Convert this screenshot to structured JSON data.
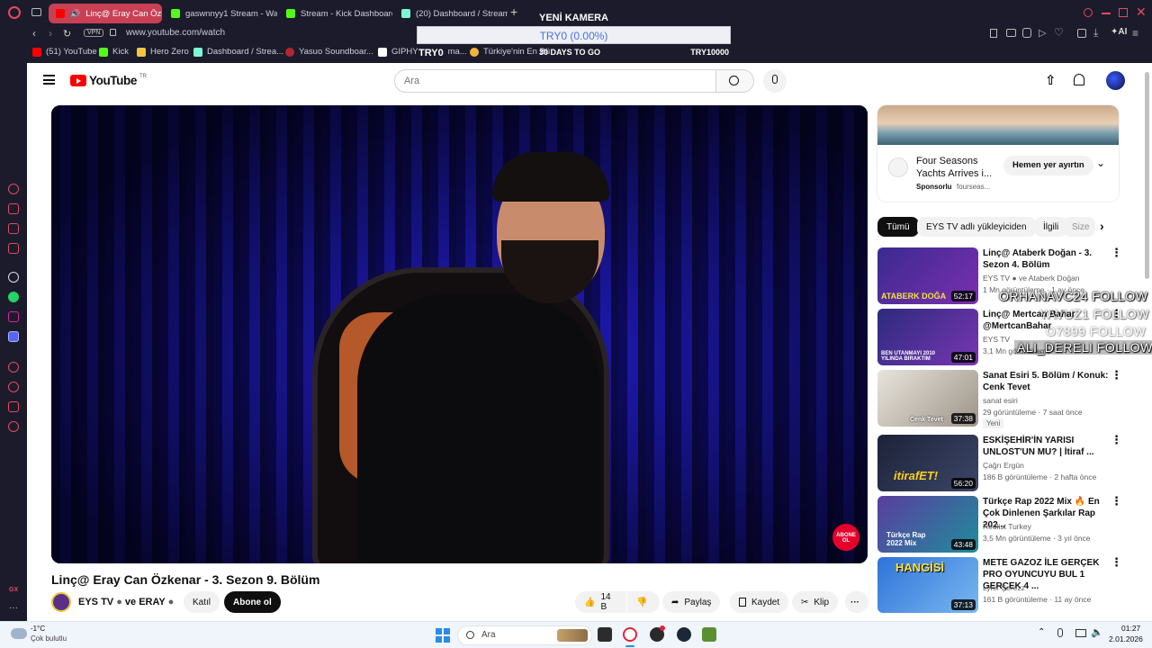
{
  "browser": {
    "tabs": [
      {
        "label": "Linç@ Eray Can Özken",
        "active": true
      },
      {
        "label": "gaswnnyy1 Stream - Watc"
      },
      {
        "label": "Stream - Kick Dashboard"
      },
      {
        "label": "(20) Dashboard / Streamlu"
      }
    ],
    "url": "www.youtube.com/watch",
    "vpn_label": "VPN",
    "ai_label": "AI",
    "bookmarks": [
      "(51) YouTube",
      "Kick",
      "Hero Zero",
      "Dashboard / Strea...",
      "Yasuo Soundboar...",
      "GIPHY",
      "Türkiye'nin En Bü"
    ]
  },
  "overlay": {
    "title": "YENİ KAMERA",
    "bar_text": "TRY0 (0.00%)",
    "progress_fraction": 0,
    "left": "TRY0",
    "center": "30 DAYS TO GO",
    "right": "TRY10000",
    "bm_suffix": "ma..."
  },
  "follows": [
    "ORHANAVC24 FOLLOW",
    "YAVUZ1 FOLLOW",
    "O7899 FOLLOW",
    "ALI_DERELI FOLLOW"
  ],
  "youtube": {
    "logo": "YouTube",
    "region": "TR",
    "search_placeholder": "Ara",
    "video": {
      "title": "Linç@ Eray Can Özkenar - 3. Sezon 9. Bölüm",
      "channel": "EYS TV",
      "channel_and": "ve ERAY",
      "join": "Katıl",
      "subscribe": "Abone ol",
      "likes": "14 B",
      "share": "Paylaş",
      "save": "Kaydet",
      "clip": "Klip",
      "overlay_sub": "ABONE OL"
    },
    "ad": {
      "title": "Four Seasons Yachts Arrives i...",
      "cta": "Hemen yer ayırtın",
      "sponsored": "Sponsorlu",
      "domain": "fourseas..."
    },
    "chips": [
      "Tümü",
      "EYS TV adlı yükleyiciden",
      "İlgili",
      "Size"
    ],
    "recommendations": [
      {
        "title": "Linç@ Ataberk Doğan - 3. Sezon 4. Bölüm",
        "channel": "EYS TV",
        "extra": "ve Ataberk Doğan",
        "meta": "1 Mn görüntüleme · 1 ay önce",
        "duration": "52:17",
        "thumb_text": "ATABERK DOĞA"
      },
      {
        "title": "Linç@ Mertcan Bahar @MertcanBahar",
        "channel": "EYS TV",
        "extra": "",
        "meta": "3,1 Mn görüntüleme",
        "duration": "47:01",
        "thumb_text": "BEN UTANMAYI 2010 YILINDA BIRAKTIM"
      },
      {
        "title": "Sanat Esiri 5. Bölüm / Konuk: Cenk Tevet",
        "channel": "sanat esiri",
        "extra": "",
        "meta": "29 görüntüleme · 7 saat önce",
        "badge": "Yeni",
        "duration": "37:38",
        "thumb_text": "Cenk Tevet"
      },
      {
        "title": "ESKİŞEHİR'İN YARISI UNLOST'UN MU? | İtiraf ...",
        "channel": "Çağrı Ergün",
        "extra": "",
        "meta": "186 B görüntüleme · 2 hafta önce",
        "duration": "56:20",
        "thumb_text": "itirafET!"
      },
      {
        "title": "Türkçe Rap 2022 Mix 🔥 En Çok Dinlenen Şarkılar Rap 202...",
        "channel": "Redlist Turkey",
        "extra": "",
        "meta": "3,5 Mn görüntüleme · 3 yıl önce",
        "duration": "43:48",
        "thumb_text": "Türkçe Rap 2022 Mix"
      },
      {
        "title": "METE GAZOZ İLE GERÇEK PRO OYUNCUYU BUL 1 GERÇEK 4 ...",
        "channel": "Lynx Çerezz",
        "extra": "",
        "meta": "161 B görüntüleme · 11 ay önce",
        "duration": "37:13",
        "thumb_text": "HANGİSİ"
      }
    ]
  },
  "taskbar": {
    "temp": "-1°C",
    "weather": "Çok bulutlu",
    "search": "Ara",
    "time": "01:27",
    "date": "2.01.2026"
  },
  "sidebar_label": "GX",
  "colors": {
    "accent": "#c94054",
    "yt_red": "#ff0000",
    "chrome_bg": "#1c1b2b"
  }
}
